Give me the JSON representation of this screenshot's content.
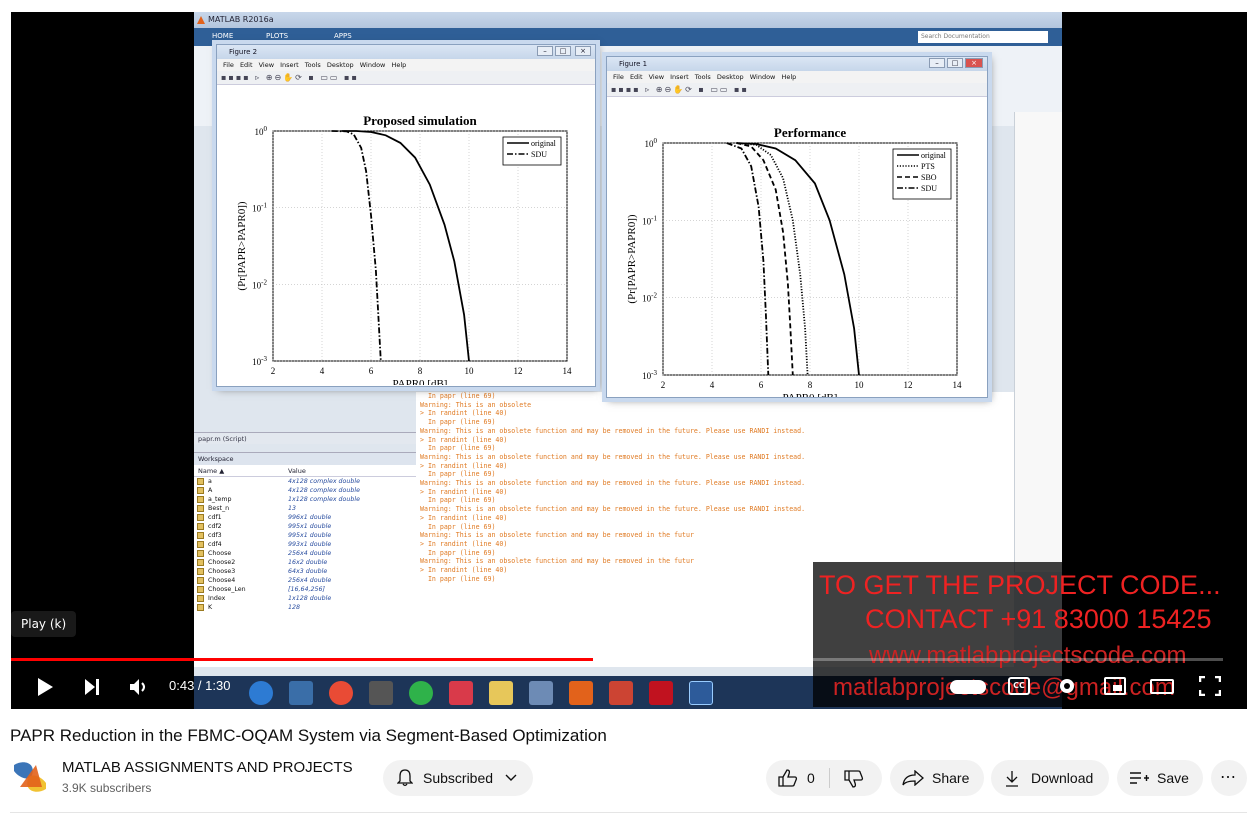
{
  "video": {
    "app_title": "MATLAB R2016a",
    "ribbon_tabs": [
      "HOME",
      "PLOTS",
      "APPS"
    ],
    "search_placeholder": "Search Documentation",
    "figure2": {
      "title": "Figure 2",
      "menu": "File  Edit  View  Insert  Tools  Desktop  Window  Help"
    },
    "figure1": {
      "title": "Figure 1",
      "menu": "File  Edit  View  Insert  Tools  Desktop  Window  Help"
    },
    "script_label": "papr.m (Script)",
    "workspace": {
      "label": "Workspace",
      "col_name": "Name ▲",
      "col_value": "Value",
      "rows": [
        {
          "name": "a",
          "value": "4x128 complex double"
        },
        {
          "name": "A",
          "value": "4x128 complex double"
        },
        {
          "name": "a_temp",
          "value": "1x128 complex double"
        },
        {
          "name": "Best_n",
          "value": "13"
        },
        {
          "name": "cdf1",
          "value": "996x1 double"
        },
        {
          "name": "cdf2",
          "value": "995x1 double"
        },
        {
          "name": "cdf3",
          "value": "995x1 double"
        },
        {
          "name": "cdf4",
          "value": "993x1 double"
        },
        {
          "name": "Choose",
          "value": "256x4 double"
        },
        {
          "name": "Choose2",
          "value": "16x2 double"
        },
        {
          "name": "Choose3",
          "value": "64x3 double"
        },
        {
          "name": "Choose4",
          "value": "256x4 double"
        },
        {
          "name": "Choose_Len",
          "value": "[16,64,256]"
        },
        {
          "name": "Index",
          "value": "1x128 double"
        },
        {
          "name": "K",
          "value": "128"
        }
      ]
    },
    "command_lines": [
      "  In papr (line 69)",
      "Warning: This is an obsolete",
      "> In randint (line 40)",
      "  In papr (line 69)",
      "Warning: This is an obsolete function and may be removed in the future. Please use RANDI instead.",
      "> In randint (line 40)",
      "  In papr (line 69)",
      "Warning: This is an obsolete function and may be removed in the future. Please use RANDI instead.",
      "> In randint (line 40)",
      "  In papr (line 69)",
      "Warning: This is an obsolete function and may be removed in the future. Please use RANDI instead.",
      "> In randint (line 40)",
      "  In papr (line 69)",
      "Warning: This is an obsolete function and may be removed in the future. Please use RANDI instead.",
      "> In randint (line 40)",
      "  In papr (line 69)",
      "Warning: This is an obsolete function and may be removed in the futur",
      "> In randint (line 40)",
      "  In papr (line 69)",
      "Warning: This is an obsolete function and may be removed in the futur",
      "> In randint (line 40)",
      "  In papr (line 69)"
    ],
    "overlay": {
      "line1": "TO GET THE PROJECT CODE...",
      "line2": "CONTACT +91 83000 15425",
      "line3": "www.matlabprojectscode.com",
      "line4": "matlabprojectscode@gmail.com"
    }
  },
  "chart_data": [
    {
      "type": "line",
      "title": "Proposed simulation",
      "xlabel": "PAPR0 [dB]",
      "ylabel": "(Pr[PAPR>PAPR0])",
      "xlim": [
        2,
        14
      ],
      "ylim": [
        0.001,
        1
      ],
      "yscale": "log",
      "xticks": [
        2,
        4,
        6,
        8,
        10,
        12,
        14
      ],
      "yticks": [
        "10^0",
        "10^-1",
        "10^-2",
        "10^-3"
      ],
      "grid": true,
      "legend_position": "top-right",
      "series": [
        {
          "name": "original",
          "style": "solid",
          "x": [
            4.8,
            5.4,
            6.0,
            6.6,
            7.2,
            7.8,
            8.4,
            9.0,
            9.4,
            9.8,
            10.0
          ],
          "y": [
            1.0,
            1.0,
            0.97,
            0.88,
            0.7,
            0.45,
            0.2,
            0.06,
            0.02,
            0.004,
            0.001
          ]
        },
        {
          "name": "SDU",
          "style": "dashdot",
          "x": [
            4.4,
            5.0,
            5.3,
            5.6,
            5.8,
            6.0,
            6.2,
            6.3,
            6.4
          ],
          "y": [
            1.0,
            0.99,
            0.9,
            0.6,
            0.3,
            0.08,
            0.015,
            0.004,
            0.001
          ]
        }
      ]
    },
    {
      "type": "line",
      "title": "Performance",
      "xlabel": "PAPR0 [dB]",
      "ylabel": "(Pr[PAPR>PAPR0])",
      "xlim": [
        2,
        14
      ],
      "ylim": [
        0.001,
        1
      ],
      "yscale": "log",
      "xticks": [
        2,
        4,
        6,
        8,
        10,
        12,
        14
      ],
      "yticks": [
        "10^0",
        "10^-1",
        "10^-2",
        "10^-3"
      ],
      "grid": true,
      "legend_position": "top-right",
      "series": [
        {
          "name": "original",
          "style": "solid",
          "x": [
            5.0,
            5.8,
            6.6,
            7.4,
            8.2,
            8.8,
            9.4,
            9.8,
            10.0
          ],
          "y": [
            1.0,
            0.97,
            0.85,
            0.6,
            0.3,
            0.1,
            0.02,
            0.004,
            0.001
          ]
        },
        {
          "name": "PTS",
          "style": "dotted",
          "x": [
            5.0,
            5.8,
            6.4,
            6.9,
            7.3,
            7.6,
            7.8,
            7.9
          ],
          "y": [
            1.0,
            0.95,
            0.7,
            0.35,
            0.1,
            0.02,
            0.004,
            0.001
          ]
        },
        {
          "name": "SBO",
          "style": "dashed",
          "x": [
            5.0,
            5.6,
            6.1,
            6.6,
            6.9,
            7.1,
            7.2,
            7.3
          ],
          "y": [
            1.0,
            0.9,
            0.6,
            0.25,
            0.07,
            0.015,
            0.004,
            0.001
          ]
        },
        {
          "name": "SDU",
          "style": "dashdot",
          "x": [
            4.6,
            5.2,
            5.6,
            5.9,
            6.1,
            6.2,
            6.3
          ],
          "y": [
            1.0,
            0.85,
            0.5,
            0.15,
            0.03,
            0.006,
            0.001
          ]
        }
      ]
    }
  ],
  "player": {
    "play_tooltip": "Play (k)",
    "time": "0:43 / 1:30",
    "progress_fraction": 0.48
  },
  "page": {
    "title": "PAPR Reduction in the FBMC-OQAM System via Segment-Based Optimization",
    "channel_name": "MATLAB ASSIGNMENTS AND PROJECTS",
    "subscribers": "3.9K subscribers",
    "subscribed_label": "Subscribed",
    "like_count": "0",
    "share_label": "Share",
    "download_label": "Download",
    "save_label": "Save"
  }
}
